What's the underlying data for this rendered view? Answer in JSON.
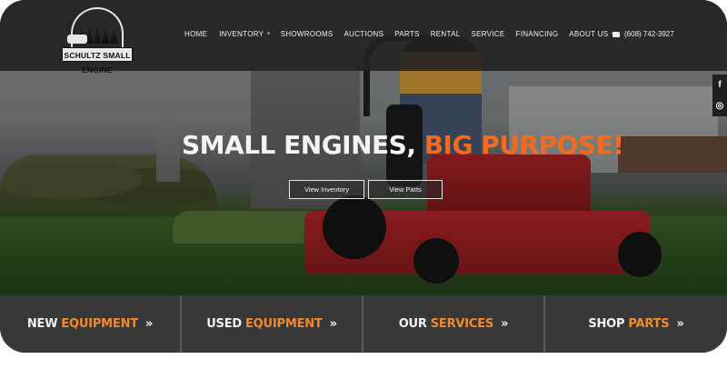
{
  "logo": {
    "text": "SCHULTZ SMALL ENGINE"
  },
  "nav": {
    "items": [
      {
        "label": "HOME",
        "dropdown": false
      },
      {
        "label": "INVENTORY",
        "dropdown": true
      },
      {
        "label": "SHOWROOMS",
        "dropdown": false
      },
      {
        "label": "AUCTIONS",
        "dropdown": false
      },
      {
        "label": "PARTS",
        "dropdown": false
      },
      {
        "label": "RENTAL",
        "dropdown": false
      },
      {
        "label": "SERVICE",
        "dropdown": false
      },
      {
        "label": "FINANCING",
        "dropdown": false
      },
      {
        "label": "ABOUT US",
        "dropdown": true
      }
    ],
    "caret": "+"
  },
  "phone": {
    "number": "(608) 742-3927",
    "icon": "envelope-icon"
  },
  "social": {
    "facebook": "f",
    "instagram": "◎"
  },
  "hero": {
    "headline_white": "SMALL ENGINES,",
    "headline_orange": "BIG PURPOSE!",
    "button_inventory": "View Inventory",
    "button_parts": "View Parts"
  },
  "ctas": [
    {
      "white": "NEW",
      "orange": "EQUIPMENT"
    },
    {
      "white": "USED",
      "orange": "EQUIPMENT"
    },
    {
      "white": "OUR",
      "orange": "SERVICES"
    },
    {
      "white": "SHOP",
      "orange": "PARTS"
    }
  ],
  "cta_chevron": "»",
  "colors": {
    "accent": "#f26b21",
    "header_bg": "#222222",
    "strip_bg": "#383838"
  }
}
